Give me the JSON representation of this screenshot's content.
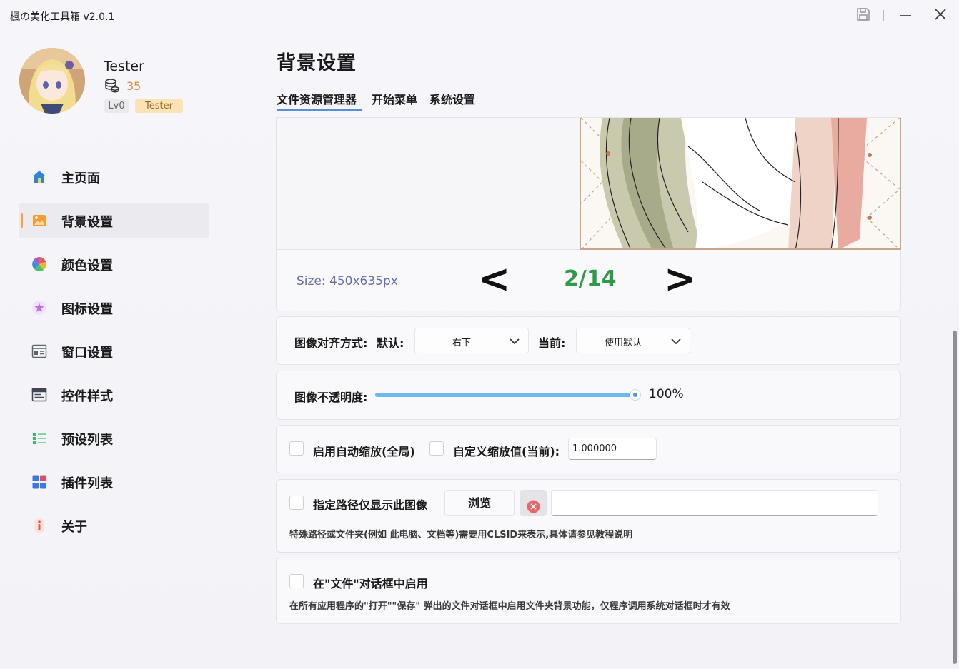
{
  "window": {
    "title": "楓の美化工具箱 v2.0.1"
  },
  "profile": {
    "name": "Tester",
    "coins": "35",
    "level_badge": "Lv0",
    "title_badge": "Tester"
  },
  "sidebar": {
    "items": [
      {
        "label": "主页面",
        "icon": "home-icon"
      },
      {
        "label": "背景设置",
        "icon": "image-icon",
        "active": true
      },
      {
        "label": "颜色设置",
        "icon": "color-wheel-icon"
      },
      {
        "label": "图标设置",
        "icon": "star-icon"
      },
      {
        "label": "窗口设置",
        "icon": "window-icon"
      },
      {
        "label": "控件样式",
        "icon": "control-style-icon"
      },
      {
        "label": "预设列表",
        "icon": "list-icon"
      },
      {
        "label": "插件列表",
        "icon": "plugin-grid-icon"
      },
      {
        "label": "关于",
        "icon": "info-icon"
      }
    ]
  },
  "main": {
    "title": "背景设置",
    "tabs": [
      {
        "label": "文件资源管理器",
        "active": true
      },
      {
        "label": "开始菜单"
      },
      {
        "label": "系统设置"
      }
    ],
    "preview": {
      "size_text": "Size: 450x635px",
      "prev_label": "<",
      "next_label": ">",
      "page_indicator": "2/14"
    },
    "alignment": {
      "label": "图像对齐方式:",
      "default_label": "默认:",
      "default_value": "右下",
      "current_label": "当前:",
      "current_value": "使用默认"
    },
    "opacity": {
      "label": "图像不透明度:",
      "value": 100,
      "value_text": "100%"
    },
    "scaling": {
      "auto_scale_label": "启用自动缩放(全局)",
      "auto_scale_checked": false,
      "custom_scale_label": "自定义缩放值(当前):",
      "custom_scale_checked": false,
      "custom_scale_value": "1.000000"
    },
    "path_filter": {
      "label": "指定路径仅显示此图像",
      "checked": false,
      "browse_label": "浏览",
      "path_value": "",
      "hint": "特殊路径或文件夹(例如 此电脑、文档等)需要用CLSID来表示,具体请参见教程说明"
    },
    "file_dialog": {
      "label": "在\"文件\"对话框中启用",
      "checked": false,
      "hint": "在所有应用程序的\"打开\"\"保存\" 弹出的文件对话框中启用文件夹背景功能，仅程序调用系统对话框时才有效"
    }
  },
  "colors": {
    "accent_tab": "#5b8fd2",
    "active_nav_bar": "#f6a23b",
    "page_indicator": "#2e9a4a",
    "size_text": "#6b6bb0",
    "slider": "#6db8ec"
  }
}
